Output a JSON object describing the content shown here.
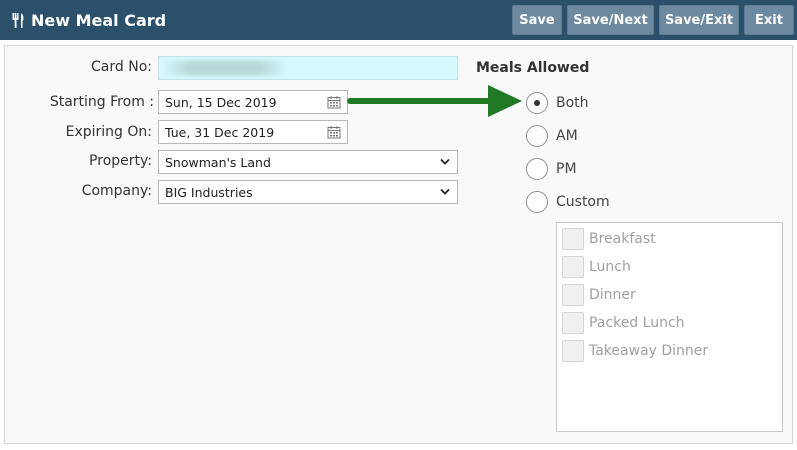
{
  "window": {
    "title": "New Meal Card",
    "icon": "fork-knife-icon"
  },
  "toolbar": {
    "save": "Save",
    "save_next": "Save/Next",
    "save_exit": "Save/Exit",
    "exit": "Exit"
  },
  "form": {
    "card_no": {
      "label": "Card No:",
      "value": ""
    },
    "starting_from": {
      "label": "Starting From :",
      "value": "Sun, 15 Dec 2019"
    },
    "expiring_on": {
      "label": "Expiring On:",
      "value": "Tue, 31 Dec 2019"
    },
    "property": {
      "label": "Property:",
      "value": "Snowman's Land"
    },
    "company": {
      "label": "Company:",
      "value": "BIG Industries"
    }
  },
  "meals": {
    "heading": "Meals Allowed",
    "options": [
      {
        "label": "Both",
        "selected": true
      },
      {
        "label": "AM",
        "selected": false
      },
      {
        "label": "PM",
        "selected": false
      },
      {
        "label": "Custom",
        "selected": false
      }
    ],
    "custom_items": [
      "Breakfast",
      "Lunch",
      "Dinner",
      "Packed Lunch",
      "Takeaway Dinner"
    ]
  },
  "colors": {
    "header": "#2b506b",
    "button": "#6d8aa1",
    "arrow": "#1f7a23",
    "card_input": "#d4f8fb"
  }
}
